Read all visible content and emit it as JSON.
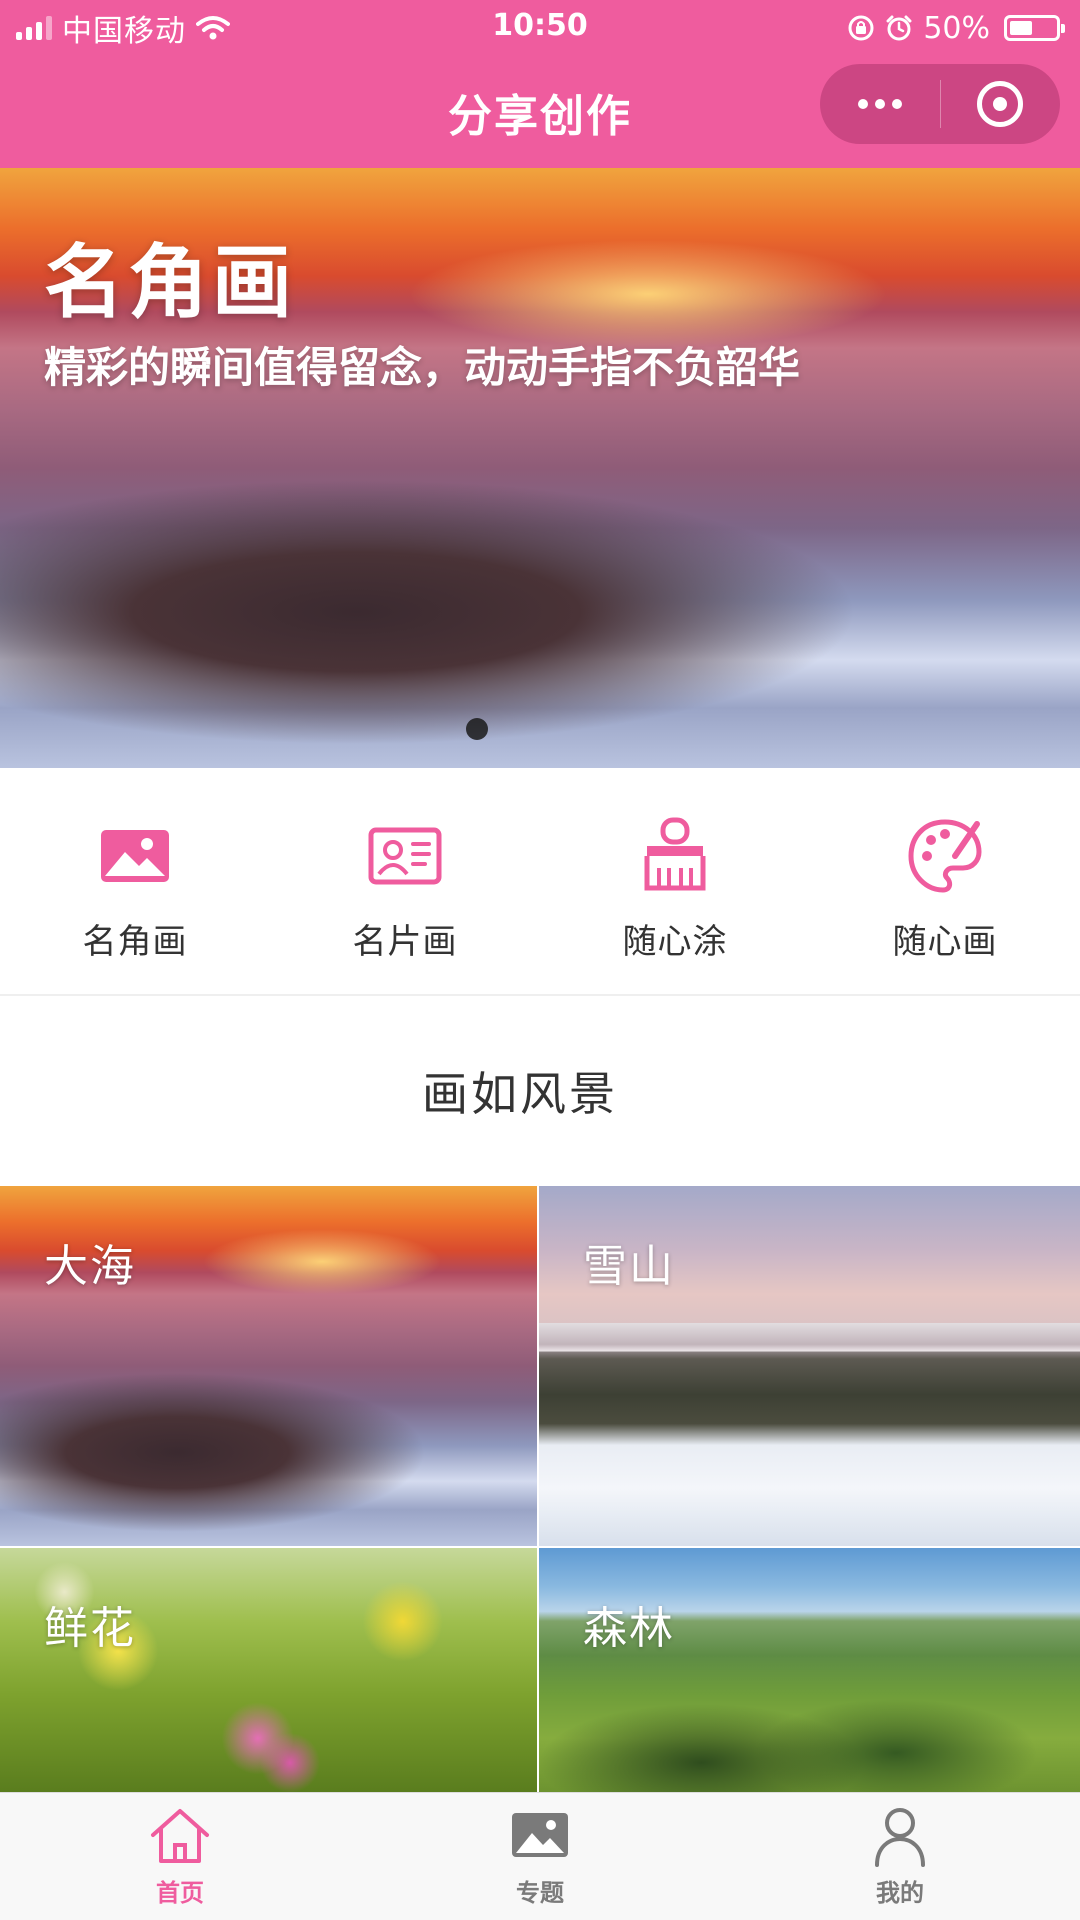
{
  "status_bar": {
    "carrier": "中国移动",
    "time": "10:50",
    "battery": "50%",
    "battery_level": 0.5
  },
  "nav": {
    "title": "分享创作",
    "more_icon": "more-dots-icon",
    "close_icon": "target-circle-icon"
  },
  "banner": {
    "title": "名角画",
    "subtitle": "精彩的瞬间值得留念，动动手指不负韶华",
    "active_slide": 1
  },
  "features": [
    {
      "label": "名角画",
      "icon": "picture-icon"
    },
    {
      "label": "名片画",
      "icon": "business-card-icon"
    },
    {
      "label": "随心涂",
      "icon": "paint-brush-icon"
    },
    {
      "label": "随心画",
      "icon": "palette-icon"
    }
  ],
  "section": {
    "title": "画如风景",
    "tiles": [
      {
        "label": "大海"
      },
      {
        "label": "雪山"
      },
      {
        "label": "鲜花"
      },
      {
        "label": "森林"
      }
    ]
  },
  "tabbar": {
    "items": [
      {
        "label": "首页",
        "icon": "home-icon",
        "active": true
      },
      {
        "label": "专题",
        "icon": "picture-icon",
        "active": false
      },
      {
        "label": "我的",
        "icon": "user-icon",
        "active": false
      }
    ]
  },
  "colors": {
    "accent": "#ef5c9e",
    "tab_inactive": "#7a7a7a",
    "text": "#333333"
  }
}
